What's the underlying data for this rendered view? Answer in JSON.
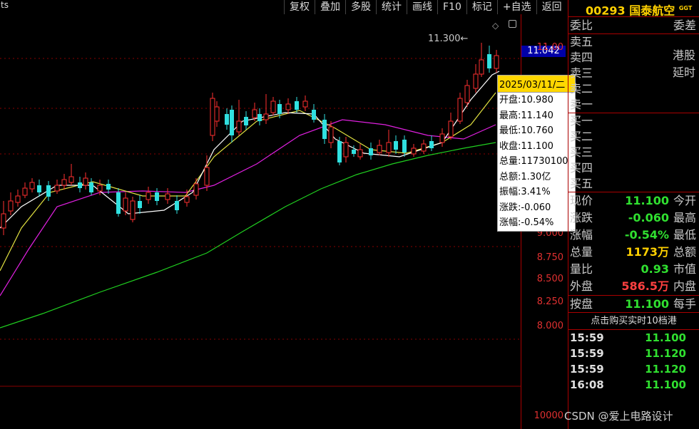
{
  "toolbar": {
    "items": [
      "复权",
      "叠加",
      "多股",
      "统计",
      "画线",
      "F10",
      "标记",
      "+自选",
      "返回"
    ]
  },
  "stock": {
    "code": "00293",
    "name": "国泰航空",
    "badge": "GGT"
  },
  "axis": {
    "current_price": "11.042",
    "labels": [
      "11.00",
      "9.000",
      "8.750",
      "8.500",
      "8.250",
      "8.000",
      "10000"
    ]
  },
  "high_marker": "11.300",
  "tooltip": {
    "date": "2025/03/11/二",
    "items": [
      "开盘:10.980",
      "最高:11.140",
      "最低:10.760",
      "收盘:11.100",
      "总量:11730100",
      "总额:1.30亿",
      "振幅:3.41%",
      "涨跌:-0.060",
      "涨幅:-0.54%"
    ]
  },
  "order_book": {
    "header": {
      "left": "委比",
      "right": "委差"
    },
    "sells": [
      "卖五",
      "卖四",
      "卖三",
      "卖二",
      "卖一"
    ],
    "buys": [
      "买一",
      "买二",
      "买三",
      "买四",
      "买五"
    ],
    "notice": [
      "港股",
      "延时"
    ]
  },
  "quote": [
    {
      "label": "现价",
      "value": "11.100",
      "right": "今开",
      "color": "#30e030"
    },
    {
      "label": "涨跌",
      "value": "-0.060",
      "right": "最高",
      "color": "#30e030"
    },
    {
      "label": "涨幅",
      "value": "-0.54%",
      "right": "最低",
      "color": "#30e030"
    },
    {
      "label": "总量",
      "value": "1173万",
      "right": "总额",
      "color": "#ffd000"
    },
    {
      "label": "量比",
      "value": "0.93",
      "right": "市值",
      "color": "#30e030"
    },
    {
      "label": "外盘",
      "value": "586.5万",
      "right": "内盘",
      "color": "#ff4040"
    }
  ],
  "press": {
    "label": "按盘",
    "value": "11.100",
    "right": "每手"
  },
  "ticks_header": "点击购买实时10档港",
  "ticks": [
    {
      "time": "15:59",
      "price": "11.100"
    },
    {
      "time": "15:59",
      "price": "11.120"
    },
    {
      "time": "15:59",
      "price": "11.120"
    },
    {
      "time": "16:08",
      "price": "11.100"
    }
  ],
  "watermark": "CSDN @爱上电路设计",
  "colors": {
    "up": "#ff3030",
    "down": "#30e0e0",
    "ma5": "#ffffff",
    "ma10": "#e0e040",
    "ma20": "#e020e0",
    "ma60": "#20d020",
    "grid": "#8a0000"
  }
}
